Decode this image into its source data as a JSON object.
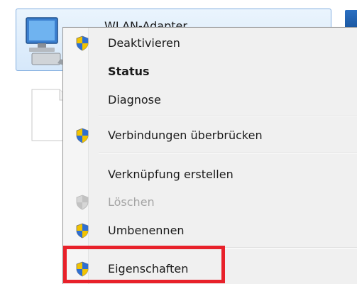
{
  "adapter": {
    "name": "WLAN-Adapter",
    "icon": "network-computer-icon"
  },
  "colors": {
    "selection_bg": "#d6e8fa",
    "selection_border": "#83aee0",
    "menu_bg": "#f0f0f0",
    "highlight": "#e8212a",
    "disabled_text": "#a4a4a4"
  },
  "context_menu": {
    "items": [
      {
        "label": "Deaktivieren",
        "icon": "uac-shield-icon",
        "enabled": true,
        "bold": false
      },
      {
        "label": "Status",
        "icon": null,
        "enabled": true,
        "bold": true
      },
      {
        "label": "Diagnose",
        "icon": null,
        "enabled": true,
        "bold": false
      },
      {
        "label": "Verbindungen überbrücken",
        "icon": "uac-shield-icon",
        "enabled": true,
        "bold": false
      },
      {
        "label": "Verknüpfung erstellen",
        "icon": null,
        "enabled": true,
        "bold": false
      },
      {
        "label": "Löschen",
        "icon": "uac-shield-icon",
        "enabled": false,
        "bold": false
      },
      {
        "label": "Umbenennen",
        "icon": "uac-shield-icon",
        "enabled": true,
        "bold": false
      },
      {
        "label": "Eigenschaften",
        "icon": "uac-shield-icon",
        "enabled": true,
        "bold": false,
        "highlighted": true
      }
    ]
  }
}
